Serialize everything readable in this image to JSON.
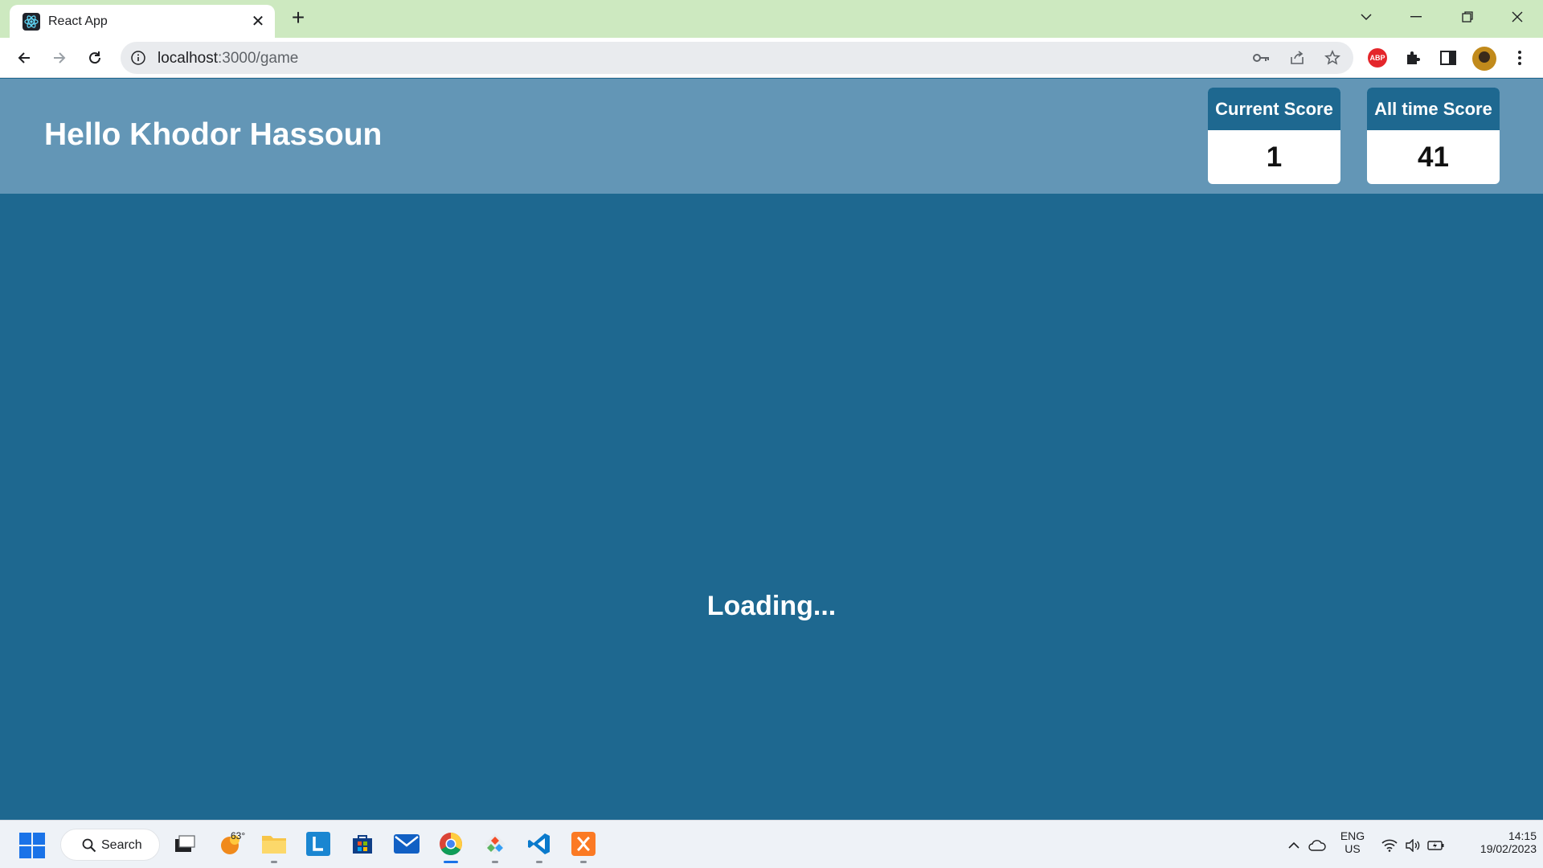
{
  "browser": {
    "tab_title": "React App",
    "url_host": "localhost",
    "url_path": ":3000/game"
  },
  "header": {
    "greeting": "Hello Khodor Hassoun"
  },
  "scores": [
    {
      "label": "Current Score",
      "value": "1"
    },
    {
      "label": "All time Score",
      "value": "41"
    }
  ],
  "main": {
    "status": "Loading..."
  },
  "taskbar": {
    "search_label": "Search",
    "weather_temp": "63°",
    "lang_1": "ENG",
    "lang_2": "US",
    "time": "14:15",
    "date": "19/02/2023"
  },
  "colors": {
    "header_bg": "#6396b6",
    "main_bg": "#1e6890",
    "tabstrip_bg": "#cde9c0"
  }
}
